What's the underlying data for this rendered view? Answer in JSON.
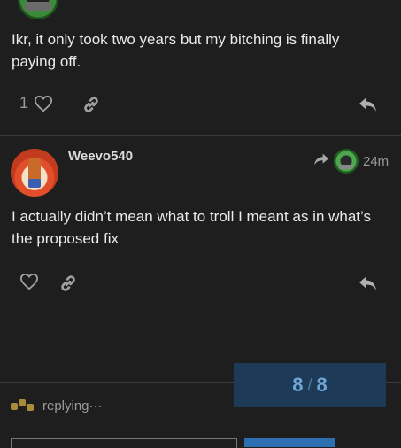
{
  "posts": [
    {
      "text": "Ikr, it only took two years but my bitching is finally paying off.",
      "likes": "1"
    },
    {
      "username": "Weevo540",
      "time": "24m",
      "text": "I actually didn’t mean what to troll I meant as in what’s the proposed fix"
    }
  ],
  "progress": {
    "current": "8",
    "separator": "/",
    "total": "8"
  },
  "composer": {
    "status": "replying···"
  },
  "colors": {
    "background": "#1e1e1e",
    "progress_bg": "#1d3a56",
    "progress_text": "#6ea6d6"
  },
  "icons": [
    "heart-icon",
    "link-icon",
    "reply-icon",
    "share-forward-icon"
  ]
}
